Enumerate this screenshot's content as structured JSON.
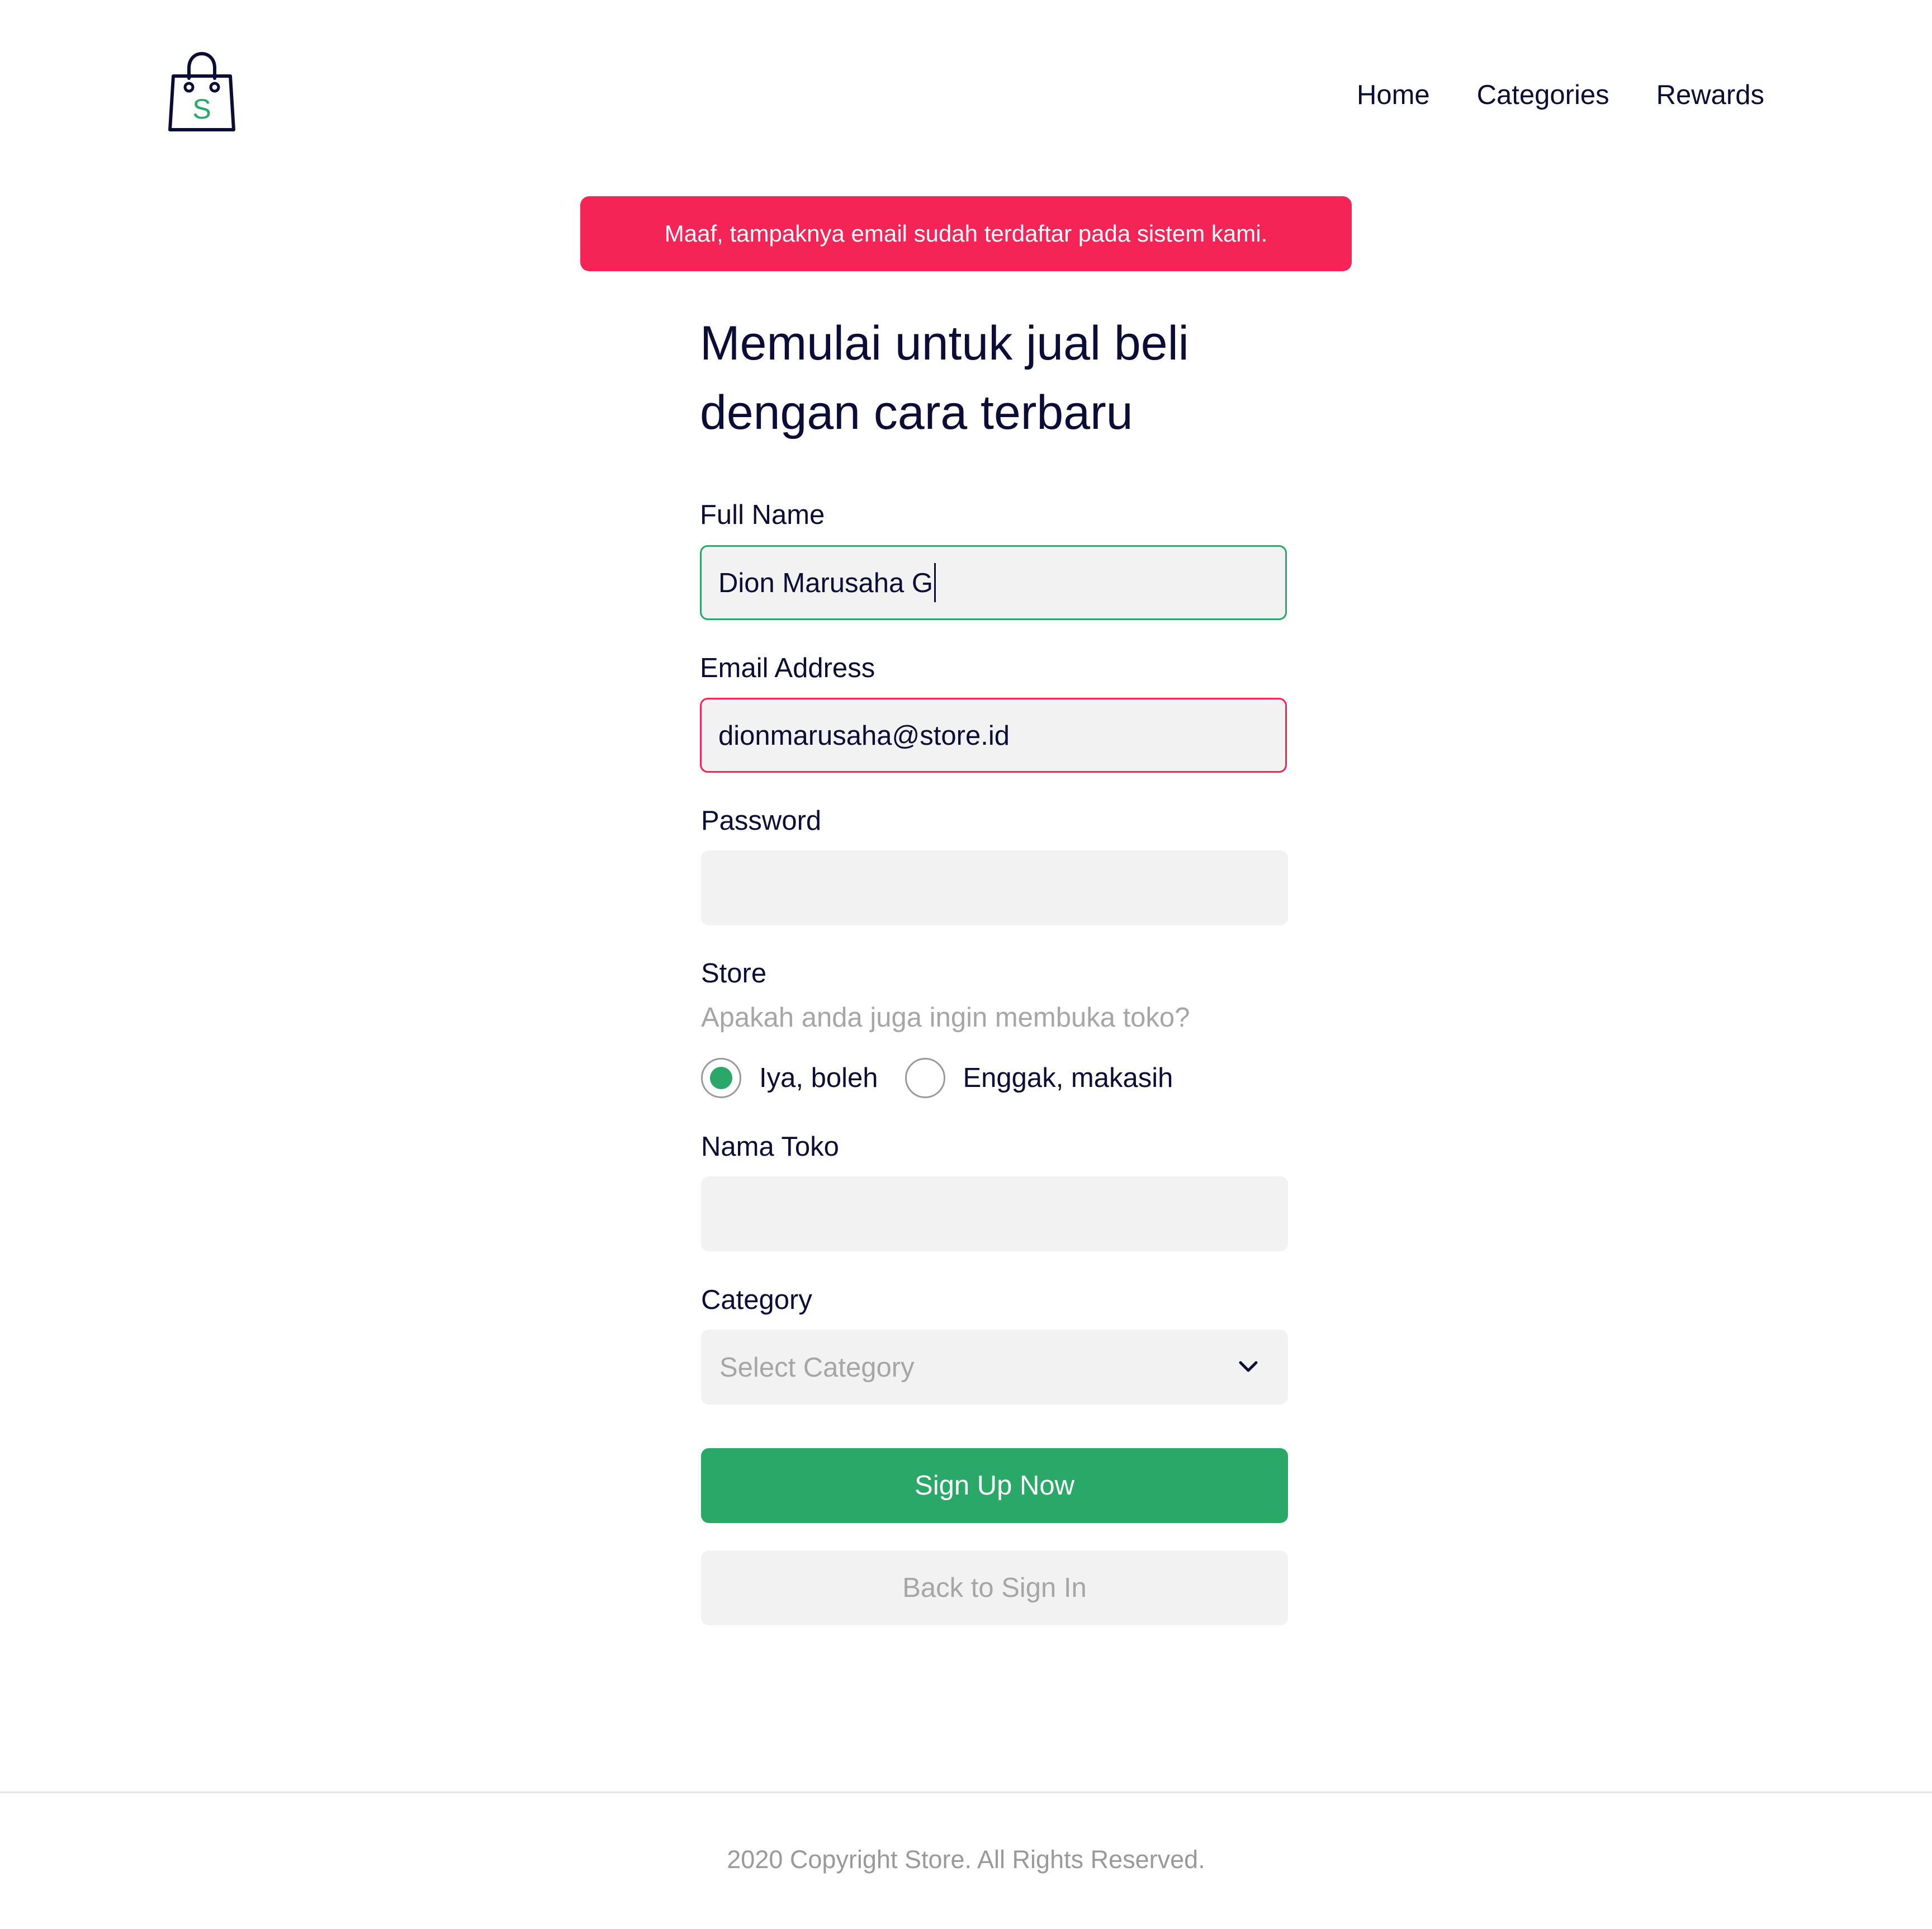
{
  "header": {
    "logo_letter": "S",
    "nav": [
      {
        "label": "Home"
      },
      {
        "label": "Categories"
      },
      {
        "label": "Rewards"
      }
    ]
  },
  "alert": {
    "message": "Maaf, tampaknya email sudah terdaftar pada sistem kami."
  },
  "form": {
    "title_line1": "Memulai untuk jual beli",
    "title_line2": "dengan cara terbaru",
    "full_name": {
      "label": "Full Name",
      "value": "Dion Marusaha G"
    },
    "email": {
      "label": "Email Address",
      "value": "dionmarusaha@store.id"
    },
    "password": {
      "label": "Password",
      "value": ""
    },
    "store": {
      "label": "Store",
      "question": "Apakah anda juga ingin membuka toko?",
      "options": [
        {
          "label": "Iya, boleh",
          "checked": true
        },
        {
          "label": "Enggak, makasih",
          "checked": false
        }
      ]
    },
    "store_name": {
      "label": "Nama Toko",
      "value": ""
    },
    "category": {
      "label": "Category",
      "placeholder": "Select Category"
    },
    "submit_label": "Sign Up Now",
    "back_label": "Back to Sign In"
  },
  "footer": {
    "copyright": "2020 Copyright Store. All Rights Reserved."
  },
  "colors": {
    "primary_green": "#29a867",
    "error_red": "#f52456",
    "text_dark": "#0c0d36",
    "muted_gray": "#a6a6a6",
    "field_bg": "#f2f2f2"
  }
}
